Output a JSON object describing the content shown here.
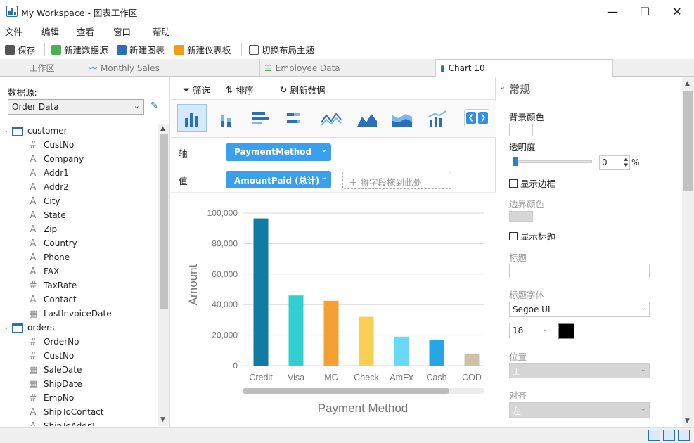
{
  "window": {
    "title": "My Workspace - 图表工作区",
    "minimize": "—",
    "maximize": "☐",
    "close": "✕"
  },
  "menu": [
    "文件",
    "编辑",
    "查看",
    "窗口",
    "帮助"
  ],
  "toolbar": {
    "save": "保存",
    "new_datasource": "新建数据源",
    "new_chart": "新建图表",
    "new_dashboard": "新建仪表板",
    "switch_theme": "切换布局主题"
  },
  "tabs": [
    "工作区",
    "Monthly Sales",
    "Employee Data",
    "Chart 10"
  ],
  "left": {
    "datasource_label": "数据源:",
    "datasource_value": "Order Data",
    "tables": [
      {
        "name": "customer",
        "fields": [
          {
            "type": "#",
            "name": "CustNo"
          },
          {
            "type": "A",
            "name": "Company"
          },
          {
            "type": "A",
            "name": "Addr1"
          },
          {
            "type": "A",
            "name": "Addr2"
          },
          {
            "type": "A",
            "name": "City"
          },
          {
            "type": "A",
            "name": "State"
          },
          {
            "type": "A",
            "name": "Zip"
          },
          {
            "type": "A",
            "name": "Country"
          },
          {
            "type": "A",
            "name": "Phone"
          },
          {
            "type": "A",
            "name": "FAX"
          },
          {
            "type": "#",
            "name": "TaxRate"
          },
          {
            "type": "A",
            "name": "Contact"
          },
          {
            "type": "date",
            "name": "LastInvoiceDate"
          }
        ]
      },
      {
        "name": "orders",
        "fields": [
          {
            "type": "#",
            "name": "OrderNo"
          },
          {
            "type": "#",
            "name": "CustNo"
          },
          {
            "type": "date",
            "name": "SaleDate"
          },
          {
            "type": "date",
            "name": "ShipDate"
          },
          {
            "type": "#",
            "name": "EmpNo"
          },
          {
            "type": "A",
            "name": "ShipToContact"
          },
          {
            "type": "A",
            "name": "ShipToAddr1"
          }
        ]
      }
    ]
  },
  "center": {
    "filter": "筛选",
    "sort": "排序",
    "refresh": "刷新数据",
    "axis_label": "轴",
    "axis_field": "PaymentMethod",
    "value_label": "值",
    "value_field": "AmountPaid (总计)",
    "drop_hint": "将字段拖到此处"
  },
  "chart_data": {
    "type": "bar",
    "categories": [
      "Credit",
      "Visa",
      "MC",
      "Check",
      "AmEx",
      "Cash",
      "COD"
    ],
    "values": [
      96500,
      46000,
      42500,
      32000,
      19000,
      16800,
      8000
    ],
    "colors": [
      "#127ba3",
      "#33cfd0",
      "#f4a134",
      "#fbcf54",
      "#6cd8f8",
      "#27a6e6",
      "#cfc1a8"
    ],
    "xlabel": "Payment Method",
    "ylabel": "Amount",
    "ylim": [
      0,
      100000
    ],
    "yticks": [
      "0",
      "20,000",
      "40,000",
      "60,000",
      "80,000",
      "100,000"
    ],
    "grid": true
  },
  "right": {
    "section": "常规",
    "bg_color": "背景颜色",
    "opacity": "透明度",
    "opacity_value": "0",
    "percent": "%",
    "show_border": "显示边框",
    "border_color": "边界颜色",
    "show_title": "显示标题",
    "title": "标题",
    "title_font": "标题字体",
    "font_name": "Segoe UI",
    "font_size": "18",
    "position": "位置",
    "position_value": "上",
    "align": "对齐",
    "align_value": "左"
  }
}
